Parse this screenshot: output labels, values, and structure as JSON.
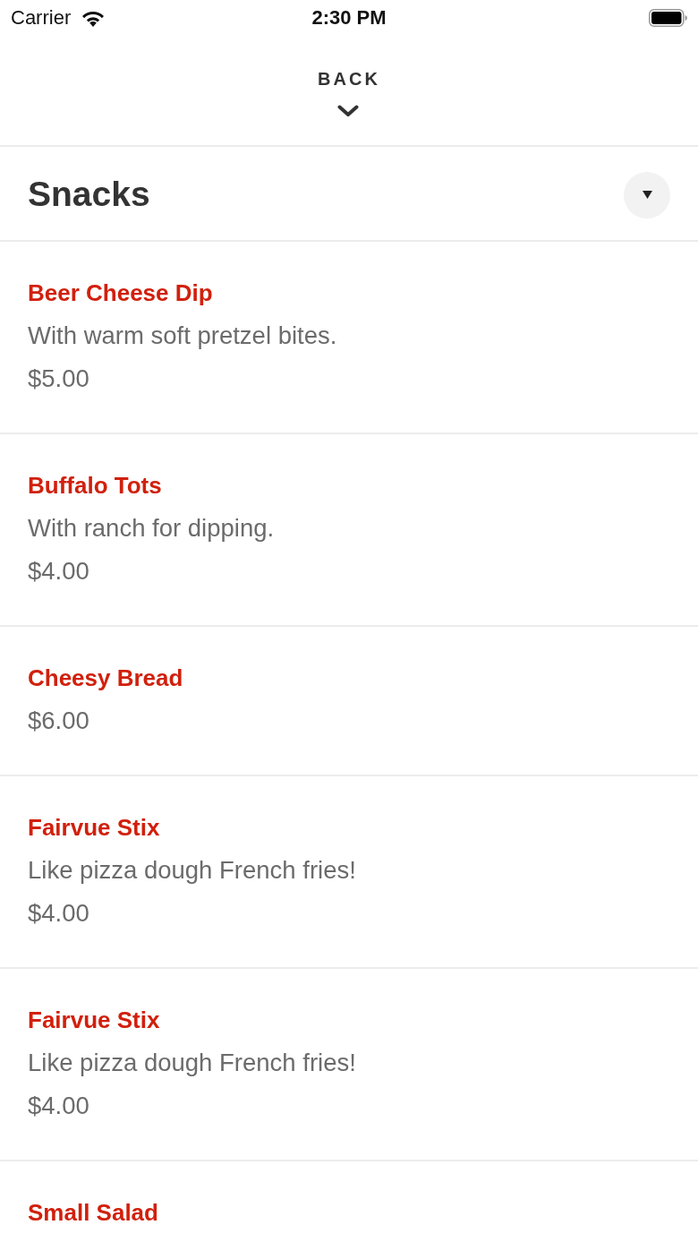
{
  "status_bar": {
    "carrier": "Carrier",
    "time": "2:30 PM"
  },
  "header": {
    "back_label": "BACK"
  },
  "section": {
    "title": "Snacks"
  },
  "items": [
    {
      "name": "Beer Cheese Dip",
      "description": "With warm soft pretzel bites.",
      "price": "$5.00"
    },
    {
      "name": "Buffalo Tots",
      "description": "With ranch for dipping.",
      "price": "$4.00"
    },
    {
      "name": "Cheesy Bread",
      "price": "$6.00"
    },
    {
      "name": "Fairvue Stix",
      "description": "Like pizza dough French fries!",
      "price": "$4.00"
    },
    {
      "name": "Fairvue Stix",
      "description": "Like pizza dough French fries!",
      "price": "$4.00"
    },
    {
      "name": "Small Salad"
    }
  ]
}
